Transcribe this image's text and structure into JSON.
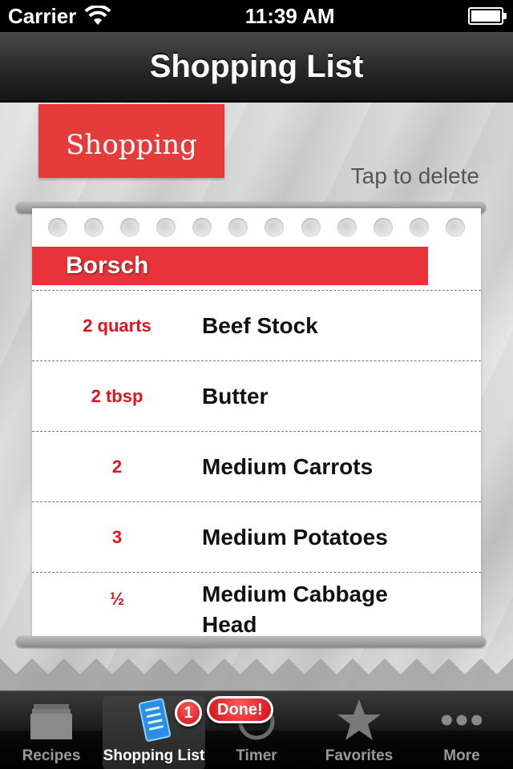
{
  "status_bar": {
    "carrier": "Carrier",
    "time": "11:39 AM",
    "battery_level": 1.0
  },
  "nav_bar": {
    "title": "Shopping List"
  },
  "section": {
    "tag_label": "Shopping",
    "hint": "Tap to delete"
  },
  "recipe": {
    "name": "Borsch",
    "items": [
      {
        "qty": "2 quarts",
        "name": "Beef Stock"
      },
      {
        "qty": "2 tbsp",
        "name": "Butter"
      },
      {
        "qty": "2",
        "name": "Medium Carrots"
      },
      {
        "qty": "3",
        "name": "Medium Potatoes"
      },
      {
        "qty": "½",
        "name": "Medium Cabbage Head"
      }
    ]
  },
  "tab_bar": {
    "tabs": [
      {
        "label": "Recipes",
        "icon": "recipe-box-icon"
      },
      {
        "label": "Shopping List",
        "icon": "shopping-list-icon",
        "badge": "1",
        "selected": true
      },
      {
        "label": "Timer",
        "icon": "timer-icon",
        "badge": "Done!"
      },
      {
        "label": "Favorites",
        "icon": "star-icon"
      },
      {
        "label": "More",
        "icon": "more-dots-icon"
      }
    ]
  },
  "colors": {
    "accent_red": "#e8333a",
    "qty_red": "#e0141c"
  }
}
